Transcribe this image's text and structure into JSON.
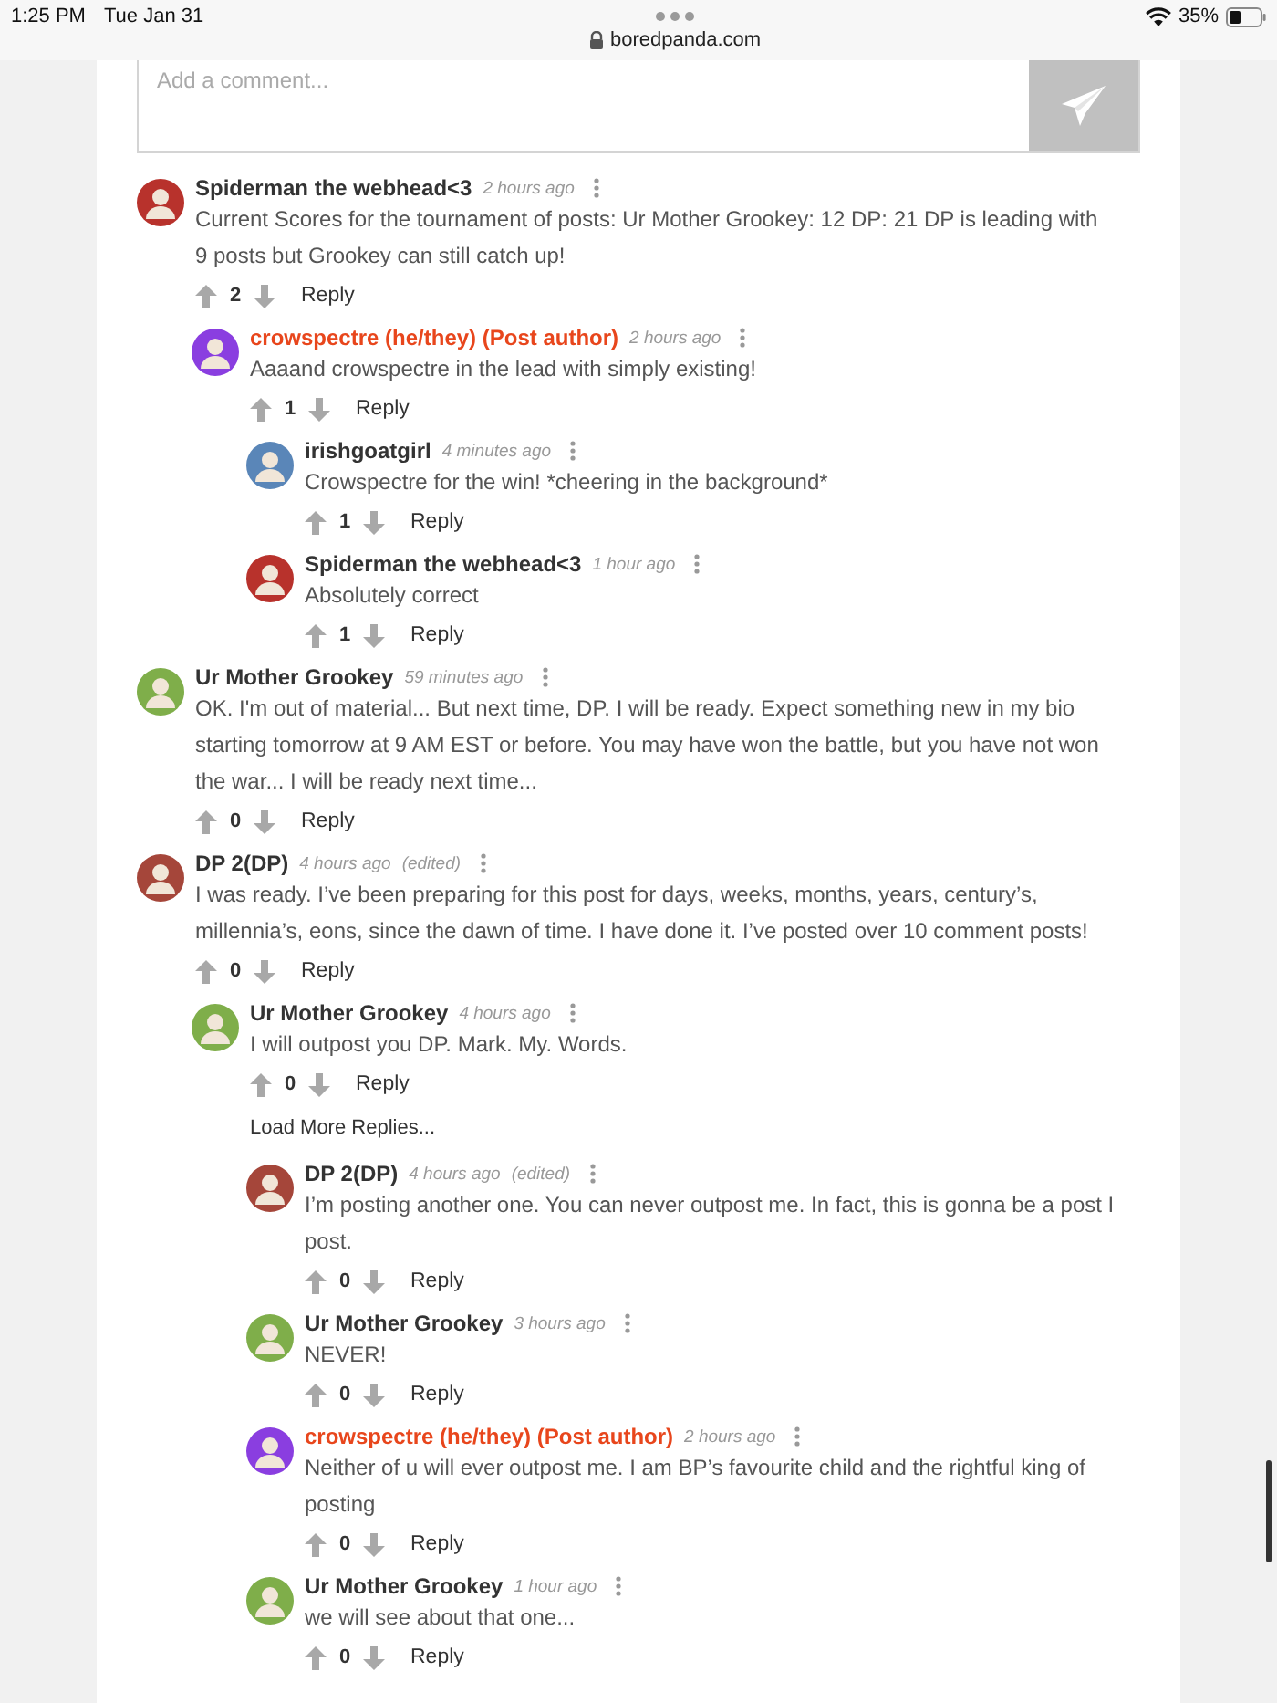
{
  "status_bar": {
    "time": "1:25 PM",
    "date": "Tue Jan 31",
    "battery": "35%"
  },
  "address_bar": {
    "url": "boredpanda.com"
  },
  "comment_box": {
    "placeholder": "Add a comment..."
  },
  "comments": [
    {
      "author": "Spiderman the webhead<3",
      "post_author": false,
      "color": "#b8322c",
      "time": "2 hours ago",
      "text": "Current Scores for the tournament of posts: Ur Mother Grookey: 12 DP: 21 DP is leading with 9 posts but Grookey can still catch up!",
      "votes": "2",
      "reply": "Reply",
      "children": [
        {
          "author": "crowspectre (he/they) (Post author)",
          "post_author": true,
          "color": "#8a3ee0",
          "time": "2 hours ago",
          "text": "Aaaand crowspectre in the lead with simply existing!",
          "votes": "1",
          "reply": "Reply",
          "children": [
            {
              "author": "irishgoatgirl",
              "post_author": false,
              "color": "#5a86b8",
              "time": "4 minutes ago",
              "text": "Crowspectre for the win! *cheering in the background*",
              "votes": "1",
              "reply": "Reply"
            },
            {
              "author": "Spiderman the webhead<3",
              "post_author": false,
              "color": "#b8322c",
              "time": "1 hour ago",
              "text": "Absolutely correct",
              "votes": "1",
              "reply": "Reply"
            }
          ]
        }
      ]
    },
    {
      "author": "Ur Mother Grookey",
      "post_author": false,
      "color": "#7fae4a",
      "time": "59 minutes ago",
      "text": "OK. I'm out of material... But next time, DP. I will be ready. Expect something new in my bio starting tomorrow at 9 AM EST or before. You may have won the battle, but you have not won the war... I will be ready next time...",
      "votes": "0",
      "reply": "Reply"
    },
    {
      "author": "DP 2(DP)",
      "post_author": false,
      "color": "#a5463a",
      "time": "4 hours ago",
      "edited": "(edited)",
      "text": "I was ready. I’ve been preparing for this post for days, weeks, months, years, century’s, millennia’s, eons, since the dawn of time. I have done it. I’ve posted over 10 comment posts!",
      "votes": "0",
      "reply": "Reply",
      "children": [
        {
          "author": "Ur Mother Grookey",
          "post_author": false,
          "color": "#7fae4a",
          "time": "4 hours ago",
          "text": "I will outpost you DP. Mark. My. Words.",
          "votes": "0",
          "reply": "Reply",
          "load_more": "Load More Replies...",
          "children": [
            {
              "author": "DP 2(DP)",
              "post_author": false,
              "color": "#a5463a",
              "time": "4 hours ago",
              "edited": "(edited)",
              "text": "I’m posting another one. You can never outpost me. In fact, this is gonna be a post I post.",
              "votes": "0",
              "reply": "Reply"
            },
            {
              "author": "Ur Mother Grookey",
              "post_author": false,
              "color": "#7fae4a",
              "time": "3 hours ago",
              "text": "NEVER!",
              "votes": "0",
              "reply": "Reply"
            },
            {
              "author": "crowspectre (he/they) (Post author)",
              "post_author": true,
              "color": "#8a3ee0",
              "time": "2 hours ago",
              "text": "Neither of u will ever outpost me. I am BP’s favourite child and the rightful king of posting",
              "votes": "0",
              "reply": "Reply"
            },
            {
              "author": "Ur Mother Grookey",
              "post_author": false,
              "color": "#7fae4a",
              "time": "1 hour ago",
              "text": "we will see about that one...",
              "votes": "0",
              "reply": "Reply"
            }
          ]
        }
      ]
    }
  ]
}
